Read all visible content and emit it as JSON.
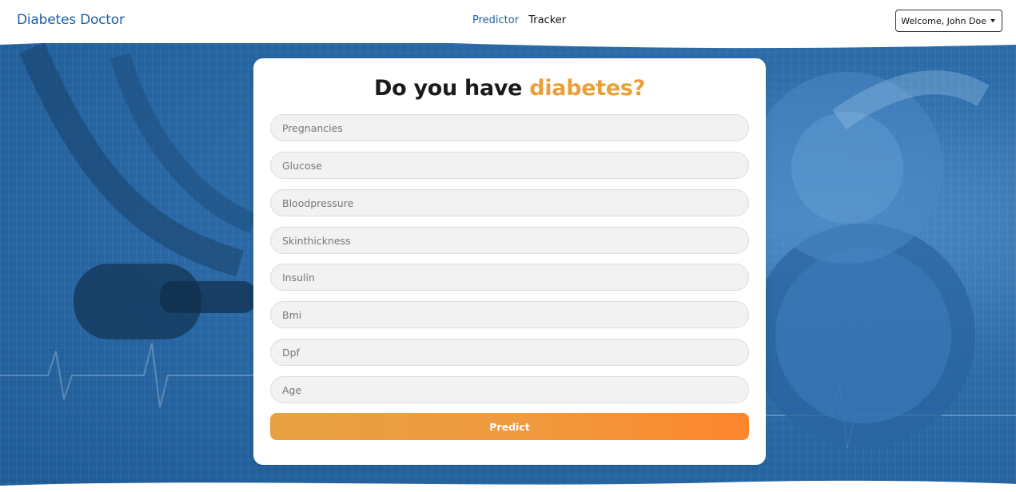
{
  "header": {
    "brand": "Diabetes Doctor",
    "nav": {
      "predictor": "Predictor",
      "tracker": "Tracker"
    },
    "user_menu": "Welcome, John Doe"
  },
  "form": {
    "title_prefix": "Do you have",
    "title_accent": "diabetes?",
    "fields": [
      {
        "placeholder": "Pregnancies"
      },
      {
        "placeholder": "Glucose"
      },
      {
        "placeholder": "Bloodpressure"
      },
      {
        "placeholder": "Skinthickness"
      },
      {
        "placeholder": "Insulin"
      },
      {
        "placeholder": "Bmi"
      },
      {
        "placeholder": "Dpf"
      },
      {
        "placeholder": "Age"
      }
    ],
    "submit_label": "Predict"
  },
  "colors": {
    "brand": "#1f5fa0",
    "accent": "#e9a03b",
    "button_gradient_start": "#e7a142",
    "button_gradient_end": "#fd852c",
    "hero_background": "#2d6ca9"
  }
}
